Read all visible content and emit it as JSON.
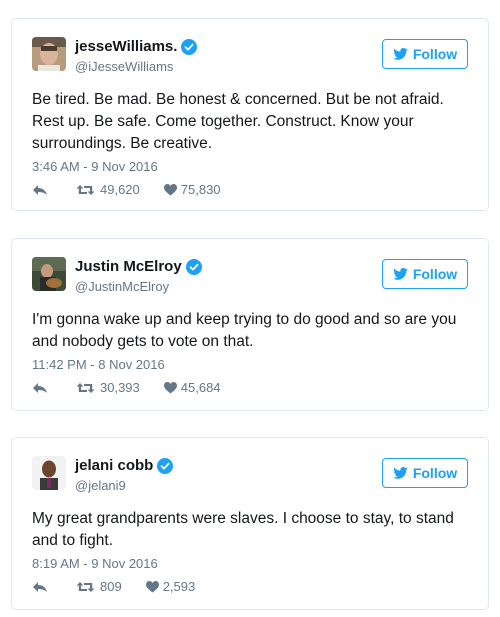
{
  "colors": {
    "accent": "#1da1f2",
    "meta": "#657786",
    "text": "#14171a",
    "border": "#e1e8ed"
  },
  "tweets": [
    {
      "name": "jesseWilliams.",
      "handle": "@iJesseWilliams",
      "verified": true,
      "follow_label": "Follow",
      "text": "Be tired. Be mad. Be honest & concerned. But be not afraid. Rest up. Be safe. Come together. Construct. Know your surroundings. Be creative.",
      "timestamp": "3:46 AM - 9 Nov 2016",
      "retweets": "49,620",
      "likes": "75,830"
    },
    {
      "name": "Justin McElroy",
      "handle": "@JustinMcElroy",
      "verified": true,
      "follow_label": "Follow",
      "text": "I'm gonna wake up and keep trying to do good and so are you and nobody gets to vote on that.",
      "timestamp": "11:42 PM - 8 Nov 2016",
      "retweets": "30,393",
      "likes": "45,684"
    },
    {
      "name": "jelani cobb",
      "handle": "@jelani9",
      "verified": true,
      "follow_label": "Follow",
      "text": "My great grandparents were slaves. I choose to stay, to stand and to fight.",
      "timestamp": "8:19 AM - 9 Nov 2016",
      "retweets": "809",
      "likes": "2,593"
    }
  ],
  "icons": [
    "verified-badge-icon",
    "twitter-bird-icon",
    "reply-icon",
    "retweet-icon",
    "heart-icon"
  ]
}
